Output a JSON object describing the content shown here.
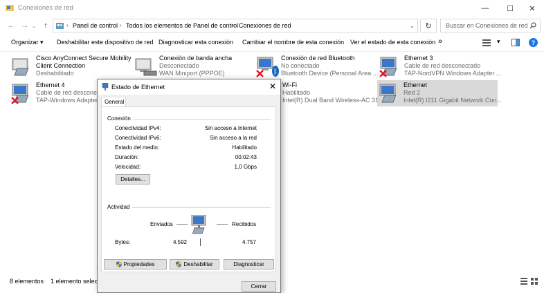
{
  "window": {
    "title": "Conexiones de red",
    "minimize": "—",
    "maximize": "☐",
    "close": "✕"
  },
  "address": {
    "crumbs": [
      "Panel de control",
      "Todos los elementos de Panel de control",
      "Conexiones de red"
    ],
    "search_placeholder": "Buscar en Conexiones de red"
  },
  "commands": {
    "organize": "Organizar ▾",
    "disable": "Deshabilitar este dispositivo de red",
    "diagnose": "Diagnosticar esta conexión",
    "rename": "Cambiar el nombre de esta conexión",
    "status": "Ver el estado de esta conexión",
    "more": "»"
  },
  "connections": [
    {
      "name": "Cisco AnyConnect Secure Mobility",
      "line2": "Client Connection",
      "line3": "Deshabilitado",
      "state": "normal"
    },
    {
      "name": "Conexión de banda ancha",
      "line2": "Desconectado",
      "line3": "WAN Miniport (PPPOE)",
      "state": "normal"
    },
    {
      "name": "Conexión de red Bluetooth",
      "line2": "No conectado",
      "line3": "Bluetooth Device (Personal Area ...",
      "state": "error"
    },
    {
      "name": "Ethernet 3",
      "line2": "Cable de red desconectado",
      "line3": "TAP-NordVPN Windows Adapter ...",
      "state": "error"
    },
    {
      "name": "Ethernet 4",
      "line2": "Cable de red desconectado",
      "line3": "TAP-Windows Adapter V...",
      "state": "error"
    },
    {
      "name": "Wi-Fi",
      "line2": "Habilitado",
      "line3": "Intel(R) Dual Band Wireless-AC 31...",
      "state": "normal"
    },
    {
      "name": "Ethernet",
      "line2": "Red 2",
      "line3": "Intel(R) I211 Gigabit Network Con...",
      "state": "normal"
    }
  ],
  "statusbar": {
    "count": "8 elementos",
    "selected": "1 elemento selecc"
  },
  "dialog": {
    "title": "Estado de Ethernet",
    "tab": "General",
    "connection_group": "Conexión",
    "fields": [
      {
        "label": "Conectividad IPv4:",
        "value": "Sin acceso a Internet"
      },
      {
        "label": "Conectividad IPv6:",
        "value": "Sin acceso a la red"
      },
      {
        "label": "Estado del medio:",
        "value": "Habilitado"
      },
      {
        "label": "Duración:",
        "value": "00:02:43"
      },
      {
        "label": "Velocidad:",
        "value": "1,0 Gbps"
      }
    ],
    "details_button": "Detalles...",
    "activity_group": "Actividad",
    "sent_label": "Enviados",
    "received_label": "Recibidos",
    "bytes_label": "Bytes:",
    "bytes_sent": "4.592",
    "bytes_received": "4.757",
    "properties_button": "Propiedades",
    "disable_button": "Deshabilitar",
    "diagnose_button": "Diagnosticar",
    "close_button": "Cerrar"
  },
  "colors": {
    "selected": "#d9d9d9",
    "error": "#e81123",
    "link_blue": "#1a73e8"
  }
}
